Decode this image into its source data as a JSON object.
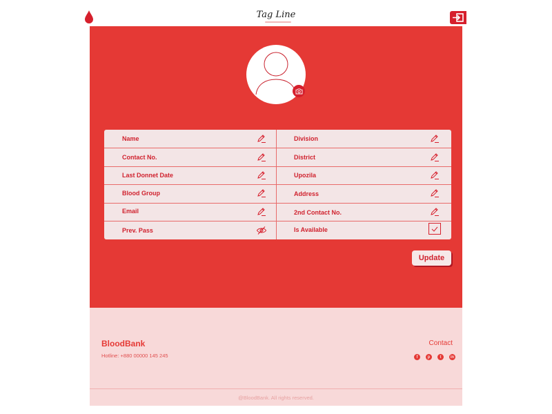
{
  "header": {
    "tagline": "Tag Line",
    "logo_icon": "blood-drop-icon",
    "logout_icon": "logout-icon"
  },
  "profile": {
    "avatar_icon": "user-avatar-icon",
    "camera_icon": "camera-icon"
  },
  "fields": {
    "left": [
      {
        "label": "Name",
        "icon": "edit-pencil-icon"
      },
      {
        "label": "Contact No.",
        "icon": "edit-pencil-icon"
      },
      {
        "label": "Last Donnet Date",
        "icon": "edit-pencil-icon"
      },
      {
        "label": "Blood Group",
        "icon": "edit-pencil-icon"
      },
      {
        "label": "Email",
        "icon": "edit-pencil-icon"
      },
      {
        "label": "Prev. Pass",
        "icon": "eye-off-icon"
      }
    ],
    "right": [
      {
        "label": "Division",
        "icon": "edit-pencil-icon"
      },
      {
        "label": "District",
        "icon": "edit-pencil-icon"
      },
      {
        "label": "Upozila",
        "icon": "edit-pencil-icon"
      },
      {
        "label": "Address",
        "icon": "edit-pencil-icon"
      },
      {
        "label": "2nd Contact No.",
        "icon": "edit-pencil-icon"
      },
      {
        "label": "Is Available",
        "icon": "checkbox-checked-icon",
        "checked": true
      }
    ]
  },
  "actions": {
    "update_label": "Update"
  },
  "footer": {
    "brand": "BloodBank",
    "hotline": "Hotline: +880 00000 145 245",
    "contact_label": "Contact",
    "social_icons": [
      "facebook-icon",
      "pinterest-icon",
      "twitter-icon",
      "linkedin-icon"
    ],
    "copyright": "@BloodBank. All rights reserved."
  },
  "colors": {
    "primary": "#e53935",
    "accent": "#d61f2c",
    "table_bg": "#f3e5e6",
    "footer_bg": "#f8d9d9"
  }
}
